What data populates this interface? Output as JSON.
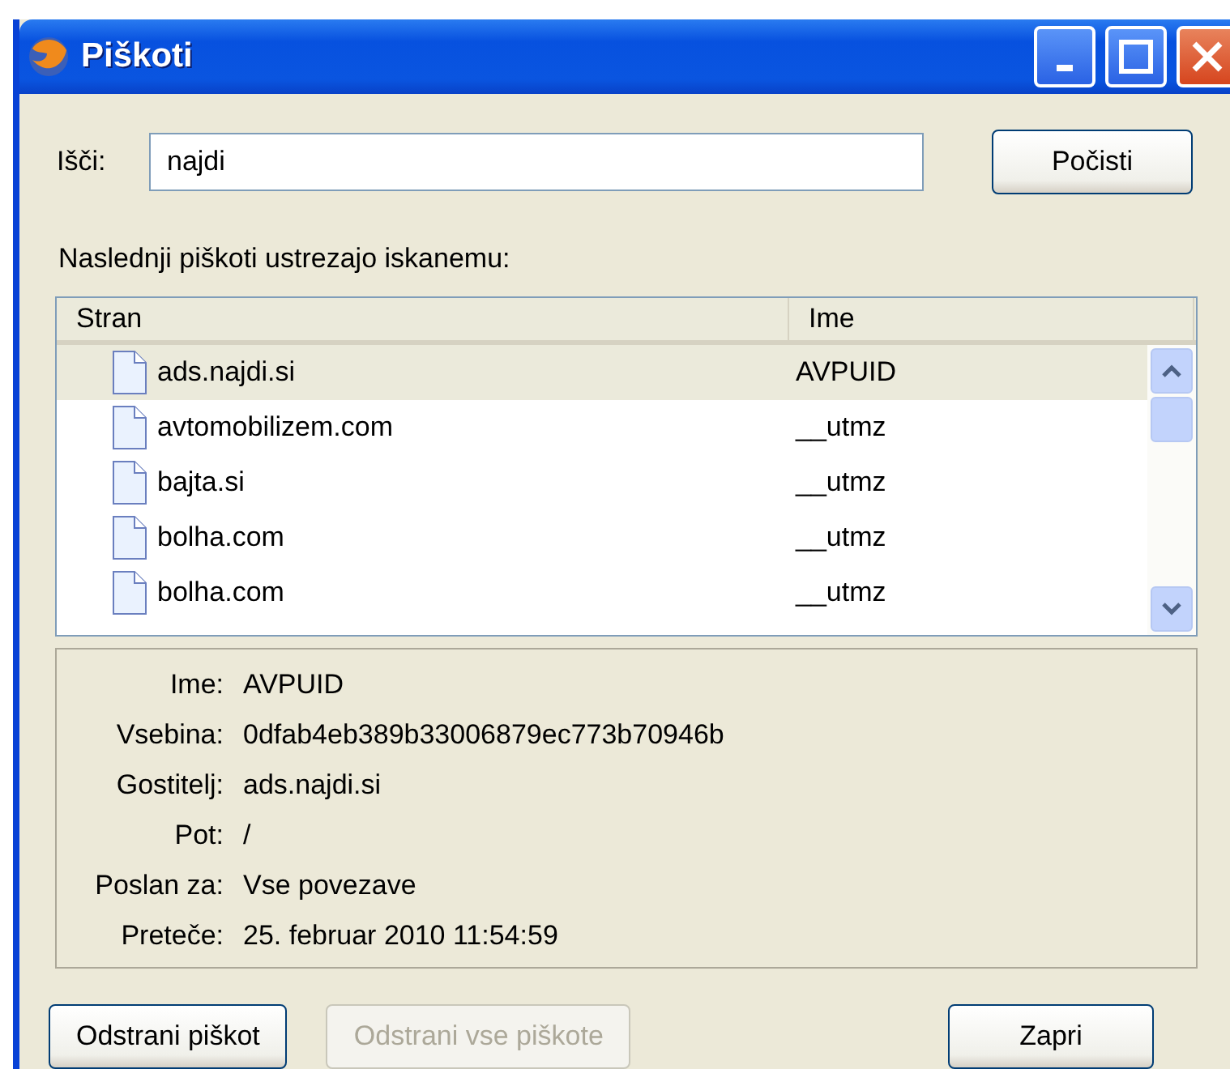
{
  "window": {
    "title": "Piškoti"
  },
  "search": {
    "label": "Išči:",
    "value": "najdi",
    "clear_button": "Počisti"
  },
  "results_label": "Naslednji piškoti ustrezajo iskanemu:",
  "table": {
    "columns": [
      "Stran",
      "Ime"
    ],
    "rows": [
      {
        "site": "ads.najdi.si",
        "name": "AVPUID",
        "selected": true
      },
      {
        "site": "avtomobilizem.com",
        "name": "__utmz",
        "selected": false
      },
      {
        "site": "bajta.si",
        "name": "__utmz",
        "selected": false
      },
      {
        "site": "bolha.com",
        "name": "__utmz",
        "selected": false
      },
      {
        "site": "bolha.com",
        "name": "__utmz",
        "selected": false
      }
    ]
  },
  "details": [
    {
      "label": "Ime:",
      "value": "AVPUID"
    },
    {
      "label": "Vsebina:",
      "value": "0dfab4eb389b33006879ec773b70946b"
    },
    {
      "label": "Gostitelj:",
      "value": "ads.najdi.si"
    },
    {
      "label": "Pot:",
      "value": "/"
    },
    {
      "label": "Poslan za:",
      "value": "Vse povezave"
    },
    {
      "label": "Preteče:",
      "value": "25. februar 2010 11:54:59"
    }
  ],
  "buttons": [
    {
      "label": "Odstrani piškot",
      "disabled": false
    },
    {
      "label": "Odstrani vse piškote",
      "disabled": true
    }
  ],
  "close_button": {
    "label": "Zapri",
    "disabled": false
  }
}
